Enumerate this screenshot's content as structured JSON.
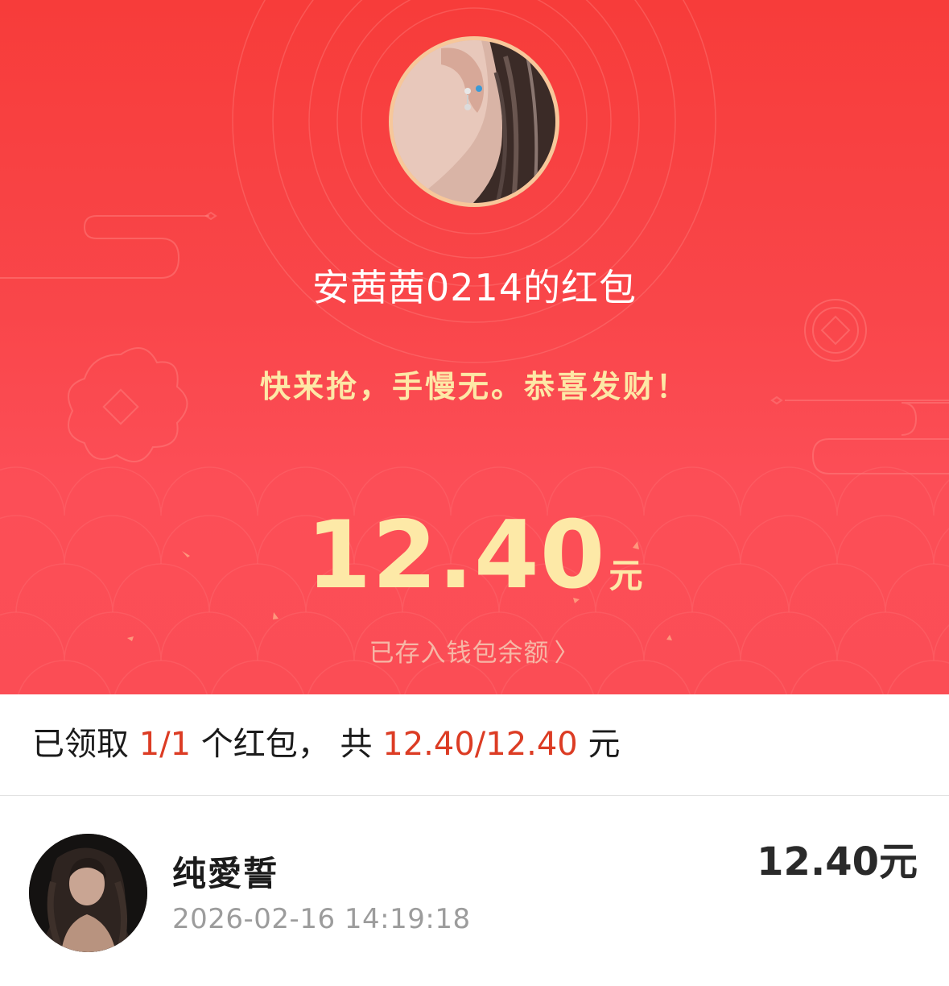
{
  "header": {
    "sender_title": "安茜茜0214的红包",
    "greeting": "快来抢，手慢无。恭喜发财！",
    "amount": "12.40",
    "amount_unit": "元",
    "wallet_link_label": "已存入钱包余额",
    "wallet_link_chevron": "〉"
  },
  "summary": {
    "prefix": "已领取 ",
    "count": "1/1",
    "middle": " 个红包， 共 ",
    "total": "12.40/12.40",
    "suffix": " 元"
  },
  "receivers": [
    {
      "name": "纯愛誓",
      "time": "2026-02-16 14:19:18",
      "amount": "12.40元"
    }
  ],
  "colors": {
    "header_red": "#f73c3a",
    "gold_text": "#fde9a7",
    "highlight": "#dc3c24",
    "avatar_border": "#f7c79a"
  },
  "icons": [
    "sender-avatar-image",
    "receiver-avatar-image",
    "chevron-right-icon"
  ]
}
